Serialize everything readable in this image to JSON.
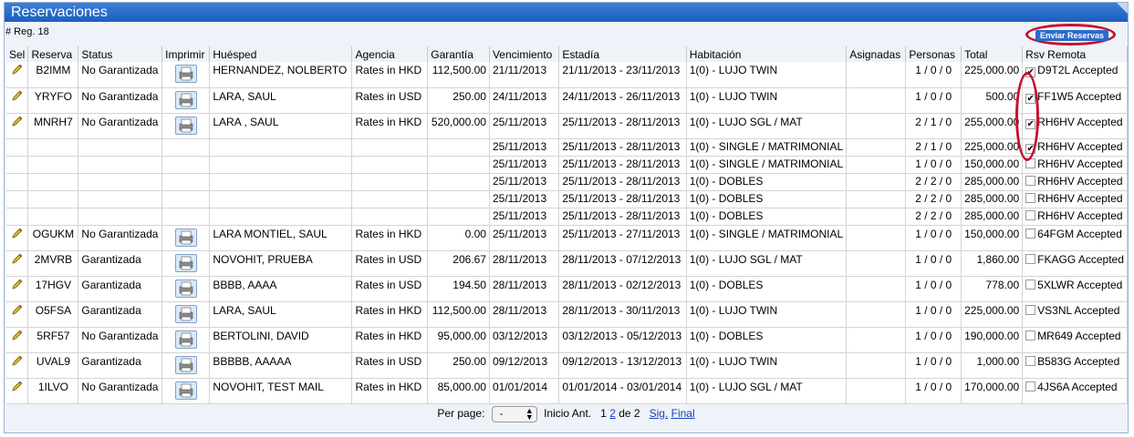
{
  "title": "Reservaciones",
  "reg_count": "# Reg. 18",
  "enviar_label": "Enviar Reservas",
  "columns": [
    "Sel",
    "Reserva",
    "Status",
    "Imprimir",
    "Huésped",
    "Agencia",
    "Garantía",
    "Vencimiento",
    "Estadía",
    "Habitación",
    "Asignadas",
    "Personas",
    "Total",
    "Rsv Remota"
  ],
  "rows": [
    {
      "main": true,
      "reserva": "B2IMM",
      "status": "No Garantizada",
      "huesped": "HERNANDEZ, NOLBERTO",
      "agencia": "Rates in HKD",
      "garantia": "112,500.00",
      "vencimiento": "21/11/2013",
      "estadia": "21/11/2013 - 23/11/2013",
      "habitacion": "1(0) - LUJO TWIN",
      "asignadas": "",
      "personas": "1 / 0 / 0",
      "total": "225,000.00",
      "checked": true,
      "remota": "D9T2L Accepted"
    },
    {
      "main": true,
      "reserva": "YRYFO",
      "status": "No Garantizada",
      "huesped": "LARA, SAUL",
      "agencia": "Rates in USD",
      "garantia": "250.00",
      "vencimiento": "24/11/2013",
      "estadia": "24/11/2013 - 26/11/2013",
      "habitacion": "1(0) - LUJO TWIN",
      "asignadas": "",
      "personas": "1 / 0 / 0",
      "total": "500.00",
      "checked": true,
      "remota": "FF1W5 Accepted"
    },
    {
      "main": true,
      "reserva": "MNRH7",
      "status": "No Garantizada",
      "huesped": "LARA , SAUL",
      "agencia": "Rates in HKD",
      "garantia": "520,000.00",
      "vencimiento": "25/11/2013",
      "estadia": "25/11/2013 - 28/11/2013",
      "habitacion": "1(0) - LUJO SGL / MAT",
      "asignadas": "",
      "personas": "2 / 1 / 0",
      "total": "255,000.00",
      "checked": true,
      "remota": "RH6HV Accepted"
    },
    {
      "main": false,
      "reserva": "",
      "status": "",
      "huesped": "",
      "agencia": "",
      "garantia": "",
      "vencimiento": "25/11/2013",
      "estadia": "25/11/2013 - 28/11/2013",
      "habitacion": "1(0) - SINGLE / MATRIMONIAL",
      "asignadas": "",
      "personas": "2 / 1 / 0",
      "total": "225,000.00",
      "checked": true,
      "remota": "RH6HV Accepted"
    },
    {
      "main": false,
      "reserva": "",
      "status": "",
      "huesped": "",
      "agencia": "",
      "garantia": "",
      "vencimiento": "25/11/2013",
      "estadia": "25/11/2013 - 28/11/2013",
      "habitacion": "1(0) - SINGLE / MATRIMONIAL",
      "asignadas": "",
      "personas": "1 / 0 / 0",
      "total": "150,000.00",
      "checked": false,
      "remota": "RH6HV Accepted"
    },
    {
      "main": false,
      "reserva": "",
      "status": "",
      "huesped": "",
      "agencia": "",
      "garantia": "",
      "vencimiento": "25/11/2013",
      "estadia": "25/11/2013 - 28/11/2013",
      "habitacion": "1(0) - DOBLES",
      "asignadas": "",
      "personas": "2 / 2 / 0",
      "total": "285,000.00",
      "checked": false,
      "remota": "RH6HV Accepted"
    },
    {
      "main": false,
      "reserva": "",
      "status": "",
      "huesped": "",
      "agencia": "",
      "garantia": "",
      "vencimiento": "25/11/2013",
      "estadia": "25/11/2013 - 28/11/2013",
      "habitacion": "1(0) - DOBLES",
      "asignadas": "",
      "personas": "2 / 2 / 0",
      "total": "285,000.00",
      "checked": false,
      "remota": "RH6HV Accepted"
    },
    {
      "main": false,
      "reserva": "",
      "status": "",
      "huesped": "",
      "agencia": "",
      "garantia": "",
      "vencimiento": "25/11/2013",
      "estadia": "25/11/2013 - 28/11/2013",
      "habitacion": "1(0) - DOBLES",
      "asignadas": "",
      "personas": "2 / 2 / 0",
      "total": "285,000.00",
      "checked": false,
      "remota": "RH6HV Accepted"
    },
    {
      "main": true,
      "reserva": "OGUKM",
      "status": "No Garantizada",
      "huesped": "LARA MONTIEL, SAUL",
      "agencia": "Rates in HKD",
      "garantia": "0.00",
      "vencimiento": "25/11/2013",
      "estadia": "25/11/2013 - 27/11/2013",
      "habitacion": "1(0) - SINGLE / MATRIMONIAL",
      "asignadas": "",
      "personas": "1 / 0 / 0",
      "total": "150,000.00",
      "checked": false,
      "remota": "64FGM Accepted"
    },
    {
      "main": true,
      "reserva": "2MVRB",
      "status": "Garantizada",
      "huesped": "NOVOHIT, PRUEBA",
      "agencia": "Rates in USD",
      "garantia": "206.67",
      "vencimiento": "28/11/2013",
      "estadia": "28/11/2013 - 07/12/2013",
      "habitacion": "1(0) - LUJO SGL / MAT",
      "asignadas": "",
      "personas": "1 / 0 / 0",
      "total": "1,860.00",
      "checked": false,
      "remota": "FKAGG Accepted"
    },
    {
      "main": true,
      "reserva": "17HGV",
      "status": "Garantizada",
      "huesped": "BBBB, AAAA",
      "agencia": "Rates in USD",
      "garantia": "194.50",
      "vencimiento": "28/11/2013",
      "estadia": "28/11/2013 - 02/12/2013",
      "habitacion": "1(0) - DOBLES",
      "asignadas": "",
      "personas": "1 / 0 / 0",
      "total": "778.00",
      "checked": false,
      "remota": "5XLWR Accepted"
    },
    {
      "main": true,
      "reserva": "O5FSA",
      "status": "Garantizada",
      "huesped": "LARA, SAUL",
      "agencia": "Rates in HKD",
      "garantia": "112,500.00",
      "vencimiento": "28/11/2013",
      "estadia": "28/11/2013 - 30/11/2013",
      "habitacion": "1(0) - LUJO TWIN",
      "asignadas": "",
      "personas": "1 / 0 / 0",
      "total": "225,000.00",
      "checked": false,
      "remota": "VS3NL Accepted"
    },
    {
      "main": true,
      "reserva": "5RF57",
      "status": "No Garantizada",
      "huesped": "BERTOLINI, DAVID",
      "agencia": "Rates in HKD",
      "garantia": "95,000.00",
      "vencimiento": "03/12/2013",
      "estadia": "03/12/2013 - 05/12/2013",
      "habitacion": "1(0) - DOBLES",
      "asignadas": "",
      "personas": "1 / 0 / 0",
      "total": "190,000.00",
      "checked": false,
      "remota": "MR649 Accepted"
    },
    {
      "main": true,
      "reserva": "UVAL9",
      "status": "Garantizada",
      "huesped": "BBBBB, AAAAA",
      "agencia": "Rates in USD",
      "garantia": "250.00",
      "vencimiento": "09/12/2013",
      "estadia": "09/12/2013 - 13/12/2013",
      "habitacion": "1(0) - LUJO TWIN",
      "asignadas": "",
      "personas": "1 / 0 / 0",
      "total": "1,000.00",
      "checked": false,
      "remota": "B583G Accepted"
    },
    {
      "main": true,
      "reserva": "1ILVO",
      "status": "No Garantizada",
      "huesped": "NOVOHIT, TEST MAIL",
      "agencia": "Rates in HKD",
      "garantia": "85,000.00",
      "vencimiento": "01/01/2014",
      "estadia": "01/01/2014 - 03/01/2014",
      "habitacion": "1(0) - LUJO SGL / MAT",
      "asignadas": "",
      "personas": "1 / 0 / 0",
      "total": "170,000.00",
      "checked": false,
      "remota": "4JS6A Accepted"
    }
  ],
  "pager": {
    "per_page_label": "Per page:",
    "per_page_value": "-",
    "inicio": "Inicio",
    "ant": "Ant.",
    "page1": "1",
    "page2": "2",
    "de": "de 2",
    "sig": "Sig.",
    "final": "Final"
  },
  "colors": {
    "title_bar": "#2a6fcf",
    "highlight_oval": "#c8102e",
    "link": "#1a3fb5"
  },
  "icons": {
    "edit": "pencil-icon",
    "print": "printer-icon",
    "dropdown": "chevron-updown-icon"
  }
}
